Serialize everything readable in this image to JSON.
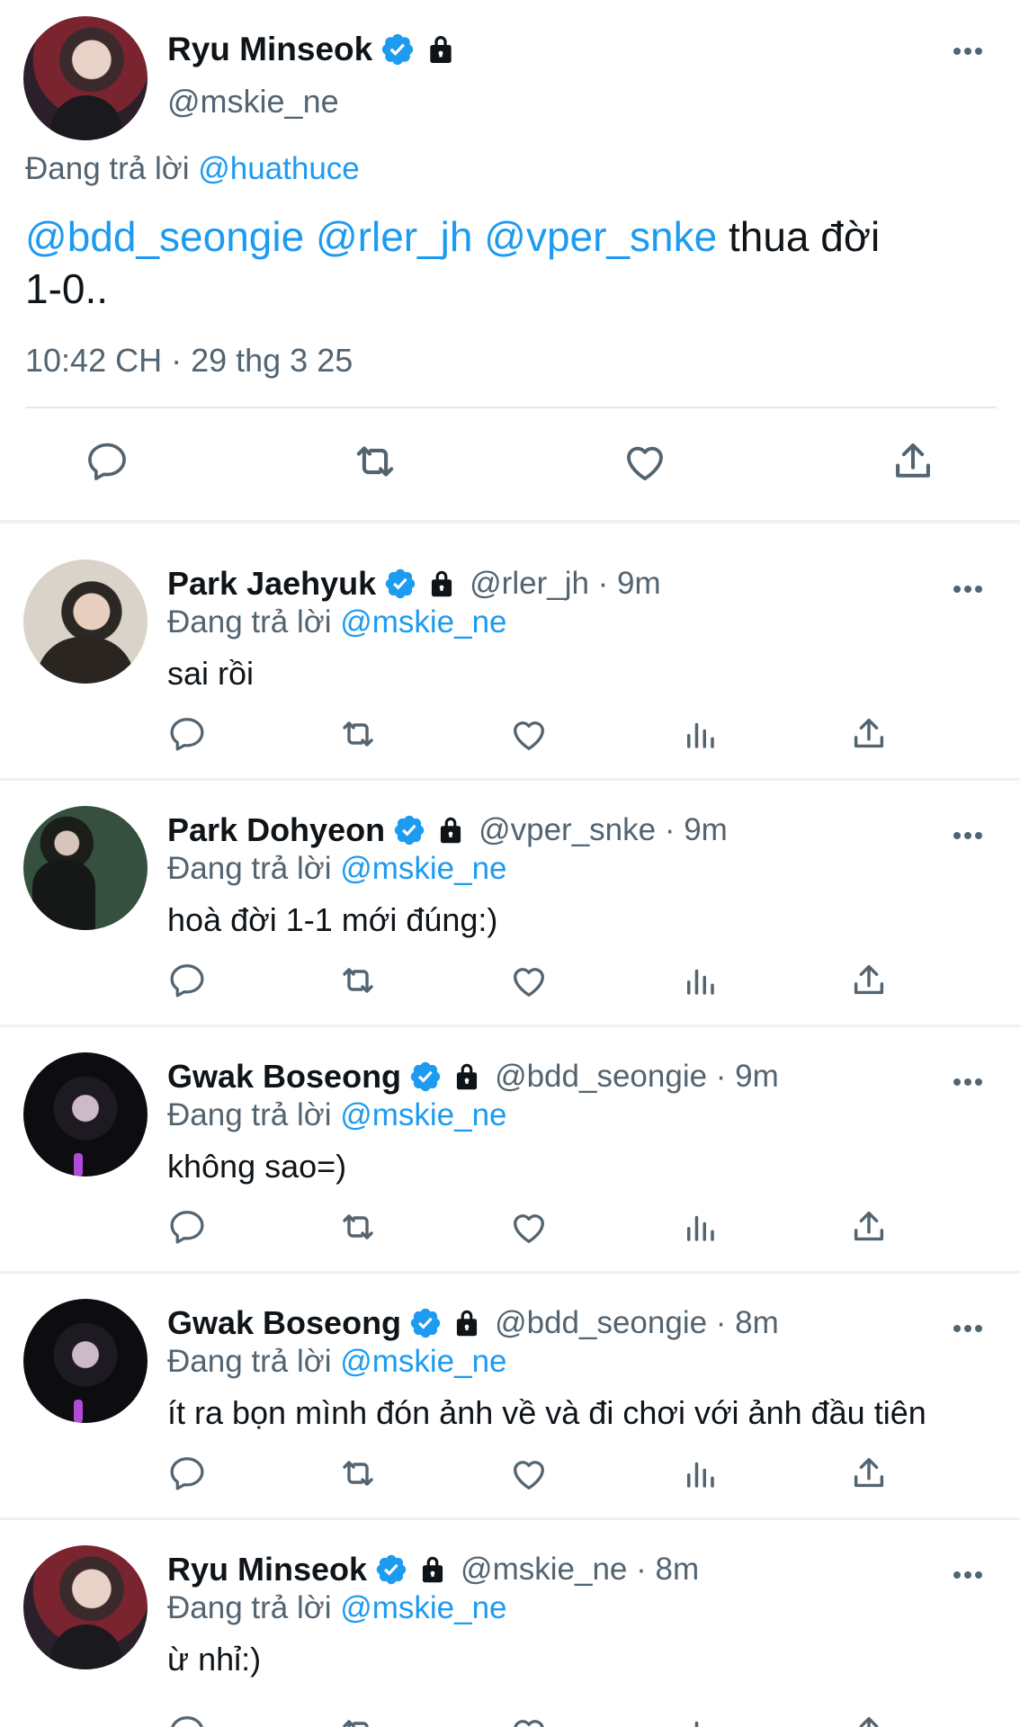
{
  "main_tweet": {
    "name": "Ryu Minseok",
    "handle": "@mskie_ne",
    "replying_label": "Đang trả lời",
    "replying_to": "@huathuce",
    "mentions": [
      "@bdd_seongie",
      "@rler_jh",
      "@vper_snke"
    ],
    "text_rest": " thua đời",
    "text_line2": "1-0..",
    "timestamp": "10:42 CH · 29 thg 3 25"
  },
  "replies": [
    {
      "name": "Park Jaehyuk",
      "meta": "@rler_jh · 9m",
      "replying_label": "Đang trả lời",
      "replying_to": "@mskie_ne",
      "text": "sai rồi"
    },
    {
      "name": "Park Dohyeon",
      "meta": "@vper_snke · 9m",
      "replying_label": "Đang trả lời",
      "replying_to": "@mskie_ne",
      "text": "hoà đời 1-1 mới đúng:)"
    },
    {
      "name": "Gwak Boseong",
      "meta": "@bdd_seongie · 9m",
      "replying_label": "Đang trả lời",
      "replying_to": "@mskie_ne",
      "text": "không sao=)"
    },
    {
      "name": "Gwak Boseong",
      "meta": "@bdd_seongie · 8m",
      "replying_label": "Đang trả lời",
      "replying_to": "@mskie_ne",
      "text": "ít ra bọn mình đón ảnh về và đi chơi với ảnh đầu tiên"
    },
    {
      "name": "Ryu Minseok",
      "meta": "@mskie_ne · 8m",
      "replying_label": "Đang trả lời",
      "replying_to": "@mskie_ne",
      "text": "ừ nhỉ:)"
    }
  ],
  "icons": [
    "verified-badge-icon",
    "lock-icon",
    "more-icon",
    "reply-icon",
    "retweet-icon",
    "like-icon",
    "views-icon",
    "share-icon"
  ],
  "colors": {
    "link": "#1d9bf0",
    "verified": "#1d9bf0",
    "secondary_text": "#536471",
    "icon": "#536471"
  }
}
